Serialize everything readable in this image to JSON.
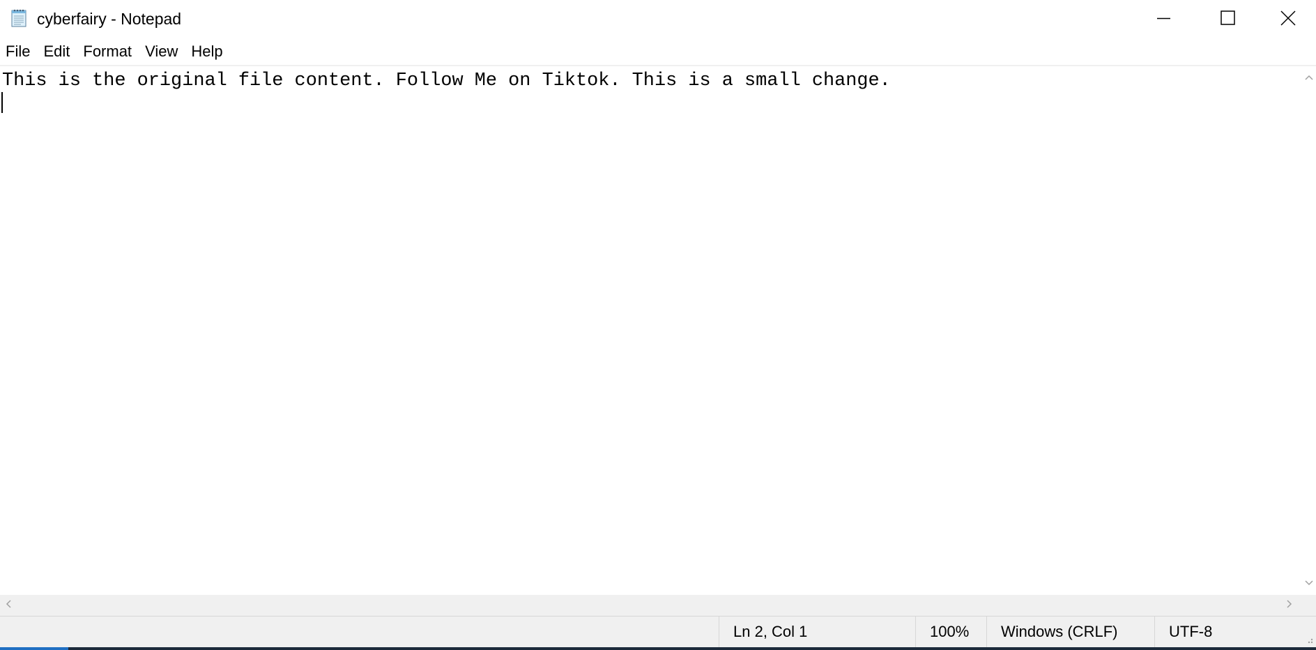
{
  "window": {
    "title": "cyberfairy - Notepad",
    "app_icon": "notepad-icon",
    "controls": {
      "minimize_icon": "minimize-icon",
      "maximize_icon": "maximize-icon",
      "close_icon": "close-icon"
    }
  },
  "menu": {
    "items": [
      {
        "label": "File"
      },
      {
        "label": "Edit"
      },
      {
        "label": "Format"
      },
      {
        "label": "View"
      },
      {
        "label": "Help"
      }
    ]
  },
  "editor": {
    "content": "This is the original file content. Follow Me on Tiktok. This is a small change."
  },
  "scrollbars": {
    "vertical": {
      "up_icon": "chevron-up-icon",
      "down_icon": "chevron-down-icon"
    },
    "horizontal": {
      "left_icon": "chevron-left-icon",
      "right_icon": "chevron-right-icon"
    }
  },
  "status": {
    "position": "Ln 2, Col 1",
    "zoom": "100%",
    "line_endings": "Windows (CRLF)",
    "encoding": "UTF-8"
  },
  "colors": {
    "chrome_background": "#f0f0f0",
    "editor_background": "#ffffff",
    "taskbar": "#1c2a3a",
    "taskbar_accent": "#1f6fc2"
  }
}
